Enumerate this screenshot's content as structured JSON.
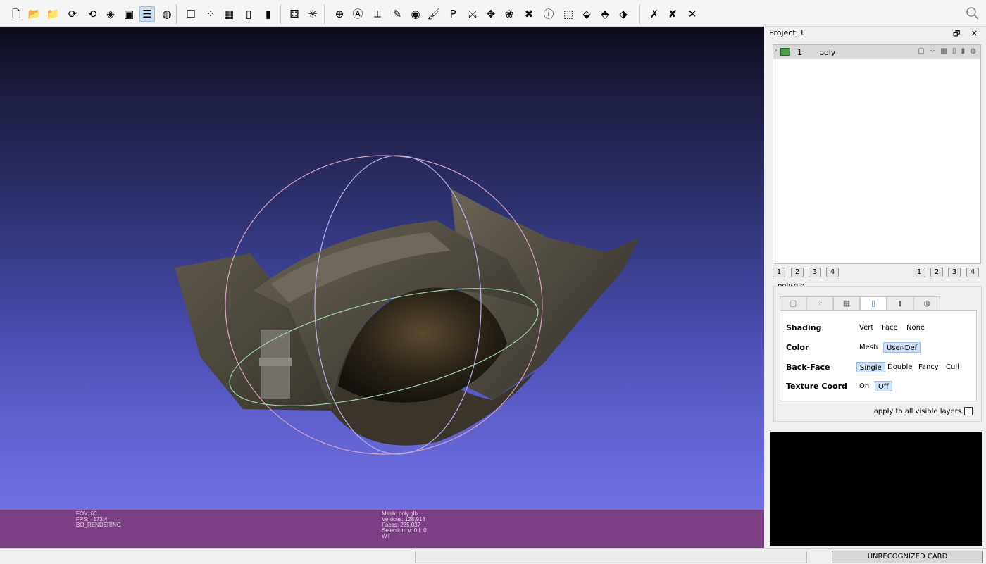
{
  "toolbar": {
    "buttons": [
      {
        "name": "new-project",
        "glyph": "🗋"
      },
      {
        "name": "open-project",
        "glyph": "📂"
      },
      {
        "name": "import-mesh",
        "glyph": "📁"
      },
      {
        "name": "reload",
        "glyph": "⟳"
      },
      {
        "name": "reload-all",
        "glyph": "⟲"
      },
      {
        "name": "export-mesh",
        "glyph": "◈"
      },
      {
        "name": "snapshot",
        "glyph": "▣"
      },
      {
        "name": "layer-dialog",
        "glyph": "☰"
      },
      {
        "name": "raster-dialog",
        "glyph": "◍"
      },
      {
        "name": "bbox-mode",
        "glyph": "☐"
      },
      {
        "name": "points-mode",
        "glyph": "⁘"
      },
      {
        "name": "wireframe-mode",
        "glyph": "▦"
      },
      {
        "name": "flat-mode",
        "glyph": "▯"
      },
      {
        "name": "smooth-mode",
        "glyph": "▮"
      },
      {
        "name": "texture-mode",
        "glyph": "⚃"
      },
      {
        "name": "axis-toggle",
        "glyph": "✳"
      },
      {
        "name": "trackball",
        "glyph": "⊕"
      },
      {
        "name": "annotation",
        "glyph": "Ⓐ"
      },
      {
        "name": "measure",
        "glyph": "⟂"
      },
      {
        "name": "paint",
        "glyph": "✎"
      },
      {
        "name": "camera",
        "glyph": "◉"
      },
      {
        "name": "brush",
        "glyph": "🖌"
      },
      {
        "name": "pick-points",
        "glyph": "P"
      },
      {
        "name": "align",
        "glyph": "⤩"
      },
      {
        "name": "manipulator",
        "glyph": "✥"
      },
      {
        "name": "color-picker",
        "glyph": "❀"
      },
      {
        "name": "georef",
        "glyph": "✖"
      },
      {
        "name": "info",
        "glyph": "ⓘ"
      },
      {
        "name": "select-faces",
        "glyph": "⬚"
      },
      {
        "name": "select-vertices",
        "glyph": "⬙"
      },
      {
        "name": "select-connected",
        "glyph": "⬘"
      },
      {
        "name": "select-all",
        "glyph": "⬗"
      },
      {
        "name": "delete-vertices",
        "glyph": "✗"
      },
      {
        "name": "delete-faces",
        "glyph": "✘"
      },
      {
        "name": "delete-all",
        "glyph": "✕"
      }
    ]
  },
  "overlay": {
    "left": {
      "fov": "FOV: 60",
      "fps": "FPS:   173.4",
      "rendering": "BO_RENDERING"
    },
    "right": {
      "mesh": "Mesh: poly.glb",
      "vertices": "Vertices: 128,918",
      "faces": "Faces: 235,037",
      "selection": "Selection: v: 0 f: 0",
      "flags": "WT"
    }
  },
  "panel": {
    "title": "Project_1",
    "controls": "🗗 ✕",
    "layer": {
      "expander": "›",
      "id": "1",
      "name": "poly",
      "icons": "▢ ⁘ ▦ ▯ ▮ ◍"
    },
    "left_numbers": [
      "1",
      "2",
      "3",
      "4"
    ],
    "right_numbers": [
      "1",
      "2",
      "3",
      "4"
    ],
    "file": "poly.glb",
    "tabs": [
      "▢",
      "⁘",
      "▦",
      "▯",
      "▮",
      "◍"
    ],
    "props": {
      "shading": {
        "label": "Shading",
        "options": [
          "Vert",
          "Face",
          "None"
        ]
      },
      "color": {
        "label": "Color",
        "options": [
          "Mesh",
          "User-Def"
        ]
      },
      "backface": {
        "label": "Back-Face",
        "options": [
          "Single",
          "Double",
          "Fancy",
          "Cull"
        ]
      },
      "texcoord": {
        "label": "Texture Coord",
        "options": [
          "On",
          "Off"
        ]
      }
    },
    "apply_label": "apply to all visible layers"
  },
  "status": {
    "card": "UNRECOGNIZED CARD"
  },
  "colors": {
    "overlay_bar": "#7c3f84",
    "viewport_bottom": "#7474e4",
    "viewport_top": "#0b0b1a",
    "selected_option": "#cde0f7"
  }
}
